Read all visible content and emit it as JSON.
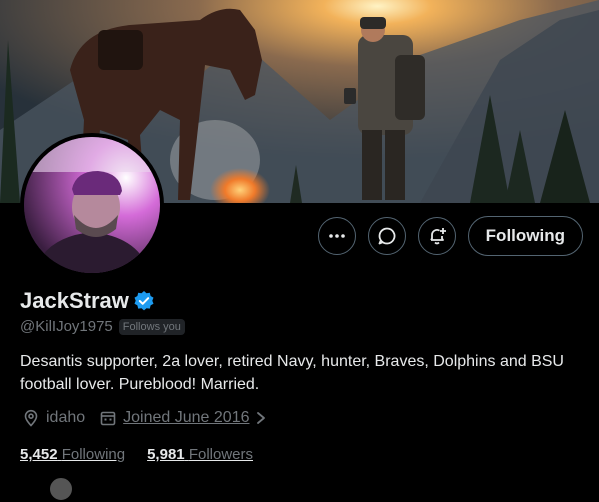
{
  "profile": {
    "display_name": "JackStraw",
    "handle": "@KilIJoy1975",
    "follows_you": "Follows you",
    "bio": "Desantis supporter, 2a lover, retired Navy, hunter, Braves, Dolphins and BSU football lover. Pureblood! Married.",
    "location": "idaho",
    "joined": "Joined June 2016",
    "following_count": "5,452",
    "following_label": "Following",
    "followers_count": "5,981",
    "followers_label": "Followers"
  },
  "actions": {
    "following_button": "Following"
  },
  "icons": {
    "more": "more-horizontal-icon",
    "message": "message-bubble-icon",
    "notify": "bell-plus-icon",
    "verified": "verified-badge-icon",
    "location": "location-pin-icon",
    "calendar": "calendar-icon",
    "chevron": "chevron-right-icon"
  },
  "colors": {
    "background": "#000000",
    "text_primary": "#e7e9ea",
    "text_secondary": "#71767b",
    "border": "#536471",
    "verified_blue": "#1d9bf0"
  }
}
